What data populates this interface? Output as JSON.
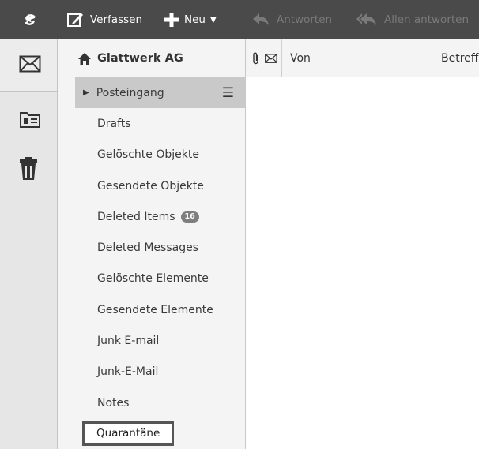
{
  "toolbar": {
    "verfassen": "Verfassen",
    "neu": "Neu",
    "neu_caret": "▼",
    "antworten": "Antworten",
    "allen_antworten": "Allen antworten"
  },
  "rail": {
    "icons": [
      "mail-icon",
      "contacts-icon",
      "trash-icon"
    ]
  },
  "account": {
    "name": "Glattwerk AG"
  },
  "folders": [
    {
      "label": "Posteingang",
      "state": "selected"
    },
    {
      "label": "Drafts"
    },
    {
      "label": "Gelöschte Objekte"
    },
    {
      "label": "Gesendete Objekte"
    },
    {
      "label": "Deleted Items",
      "badge": "16"
    },
    {
      "label": "Deleted Messages"
    },
    {
      "label": "Gelöschte Elemente"
    },
    {
      "label": "Gesendete Elemente"
    },
    {
      "label": "Junk E-mail"
    },
    {
      "label": "Junk-E-Mail"
    },
    {
      "label": "Notes"
    },
    {
      "label": "Quarantäne",
      "state": "highlighted"
    }
  ],
  "message_list": {
    "columns": {
      "from": "Von",
      "subject": "Betreff"
    }
  }
}
